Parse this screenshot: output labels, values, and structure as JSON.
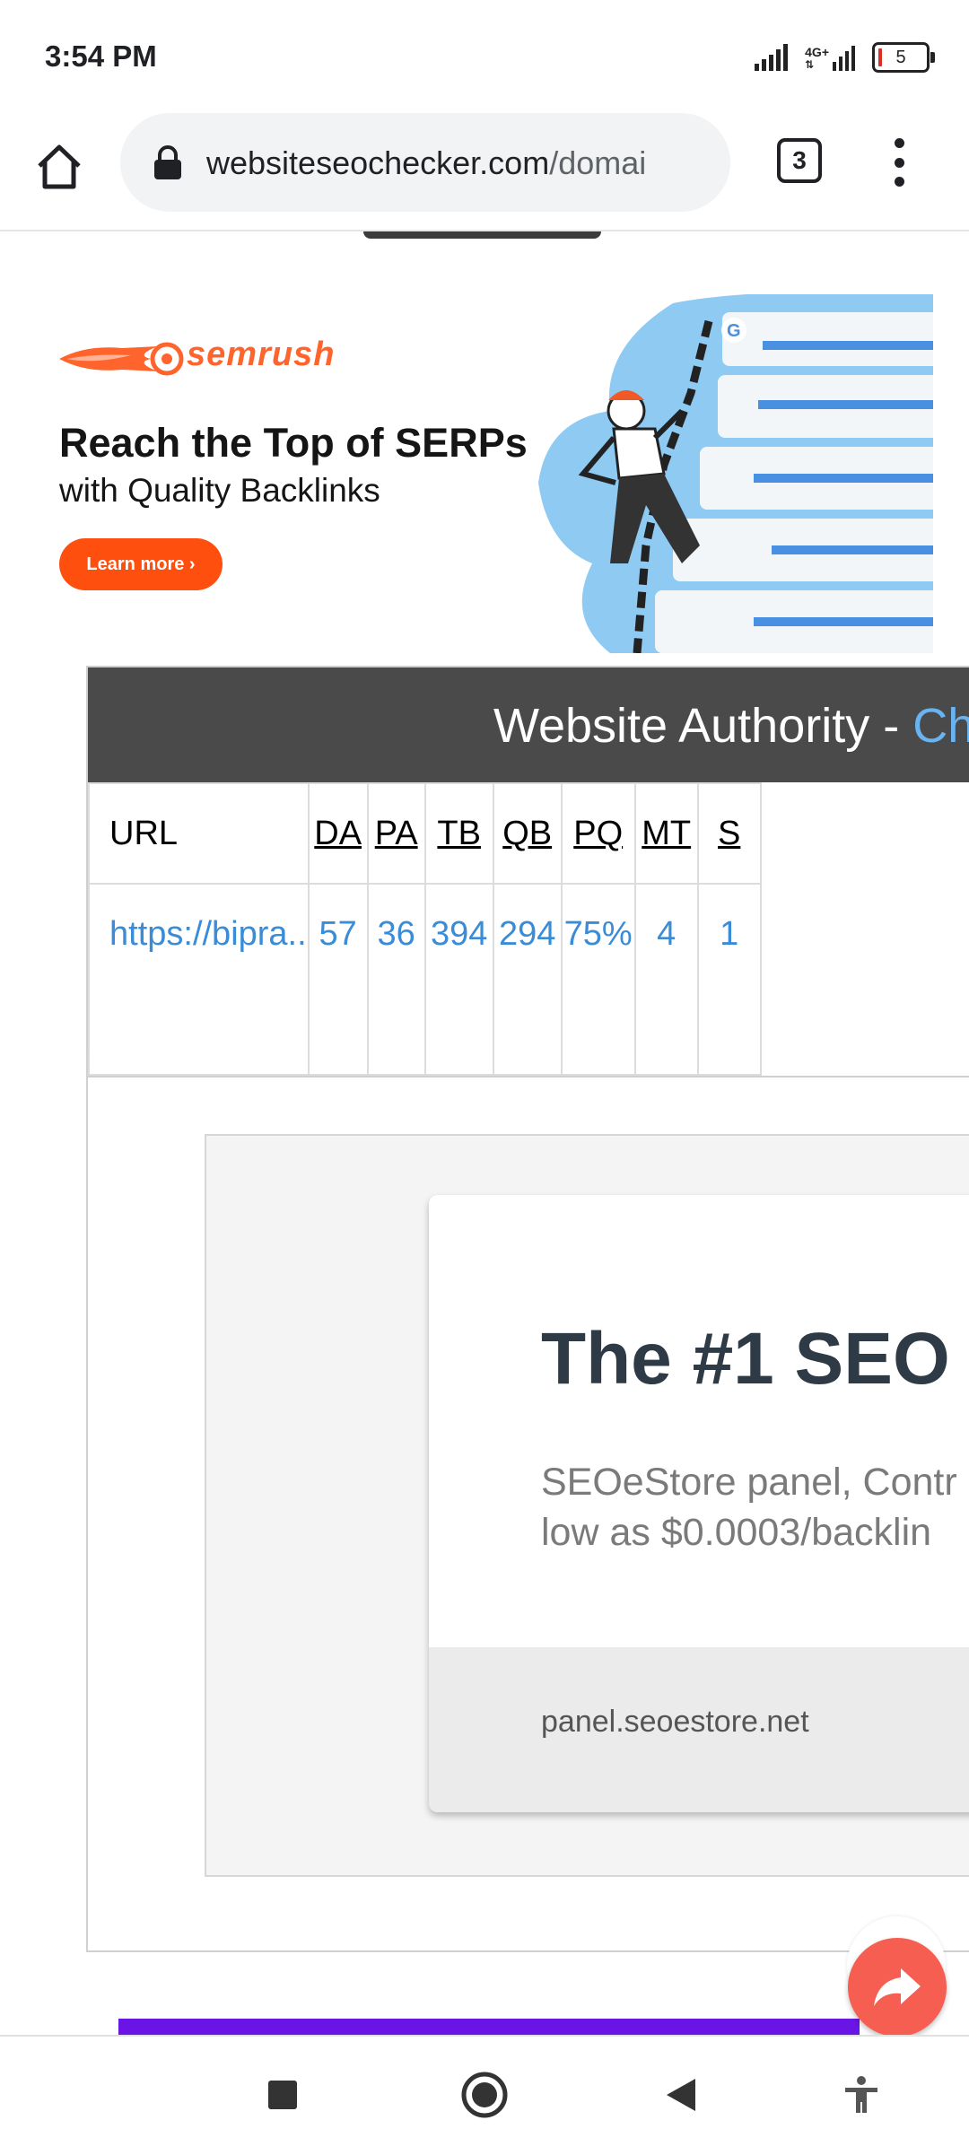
{
  "status_bar": {
    "time": "3:54 PM",
    "network_label": "4G+",
    "battery_level": "5"
  },
  "browser": {
    "url_domain": "websiteseochecker.com",
    "url_path": "/domai",
    "tab_count": "3",
    "icons": [
      "home-icon",
      "lock-icon",
      "tab-switcher-icon",
      "more-vert-icon"
    ]
  },
  "ad_semrush": {
    "brand": "semrush",
    "headline": "Reach the Top of SERPs",
    "subline": "with Quality Backlinks",
    "cta": "Learn more ›",
    "colors": {
      "brand": "#ff642d",
      "cta_bg": "#ff4f0f",
      "art_bg": "#8ecaf2"
    }
  },
  "authority_table": {
    "title": "Website Authority - ",
    "title_accent": "Ch",
    "header_bg": "#4a4a4a",
    "columns": [
      "URL",
      "DA",
      "PA",
      "TB",
      "QB",
      "PQ",
      "MT",
      "S"
    ],
    "row": [
      "https://bipra..",
      "57",
      "36",
      "394",
      "294",
      "75%",
      "4",
      "1"
    ],
    "link_color": "#3a8cd6"
  },
  "ad_seoestore": {
    "title": "The #1 SEO",
    "description_line1": "SEOeStore panel, Contr",
    "description_line2": "low as $0.0003/backlin",
    "domain": "panel.seoestore.net"
  },
  "fab": {
    "icon": "share-arrow-icon",
    "color": "#f65e52"
  },
  "nav_bar": {
    "icons": [
      "recents-square-icon",
      "home-circle-icon",
      "back-triangle-icon",
      "accessibility-icon"
    ]
  }
}
